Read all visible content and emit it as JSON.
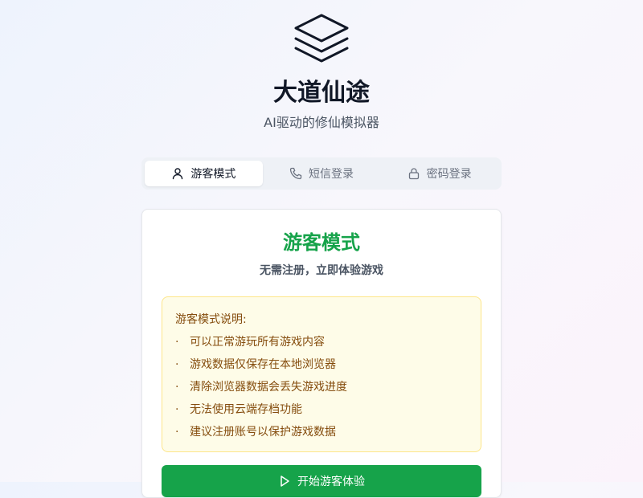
{
  "header": {
    "logo_icon": "layers-icon",
    "title": "大道仙途",
    "subtitle": "AI驱动的修仙模拟器"
  },
  "tabs": [
    {
      "label": "游客模式",
      "icon": "user-icon",
      "active": true
    },
    {
      "label": "短信登录",
      "icon": "phone-icon",
      "active": false
    },
    {
      "label": "密码登录",
      "icon": "lock-icon",
      "active": false
    }
  ],
  "card": {
    "title": "游客模式",
    "subtitle": "无需注册，立即体验游戏",
    "notice": {
      "title": "游客模式说明:",
      "bullet": "·",
      "items": [
        "可以正常游玩所有游戏内容",
        "游戏数据仅保存在本地浏览器",
        "清除浏览器数据会丢失游戏进度",
        "无法使用云端存档功能",
        "建议注册账号以保护游戏数据"
      ]
    },
    "button": {
      "label": "开始游客体验",
      "icon": "play-icon"
    }
  },
  "colors": {
    "accent_green": "#16a34a",
    "notice_bg": "#fefce8",
    "notice_border": "#fde68a",
    "notice_text": "#854d0e"
  }
}
